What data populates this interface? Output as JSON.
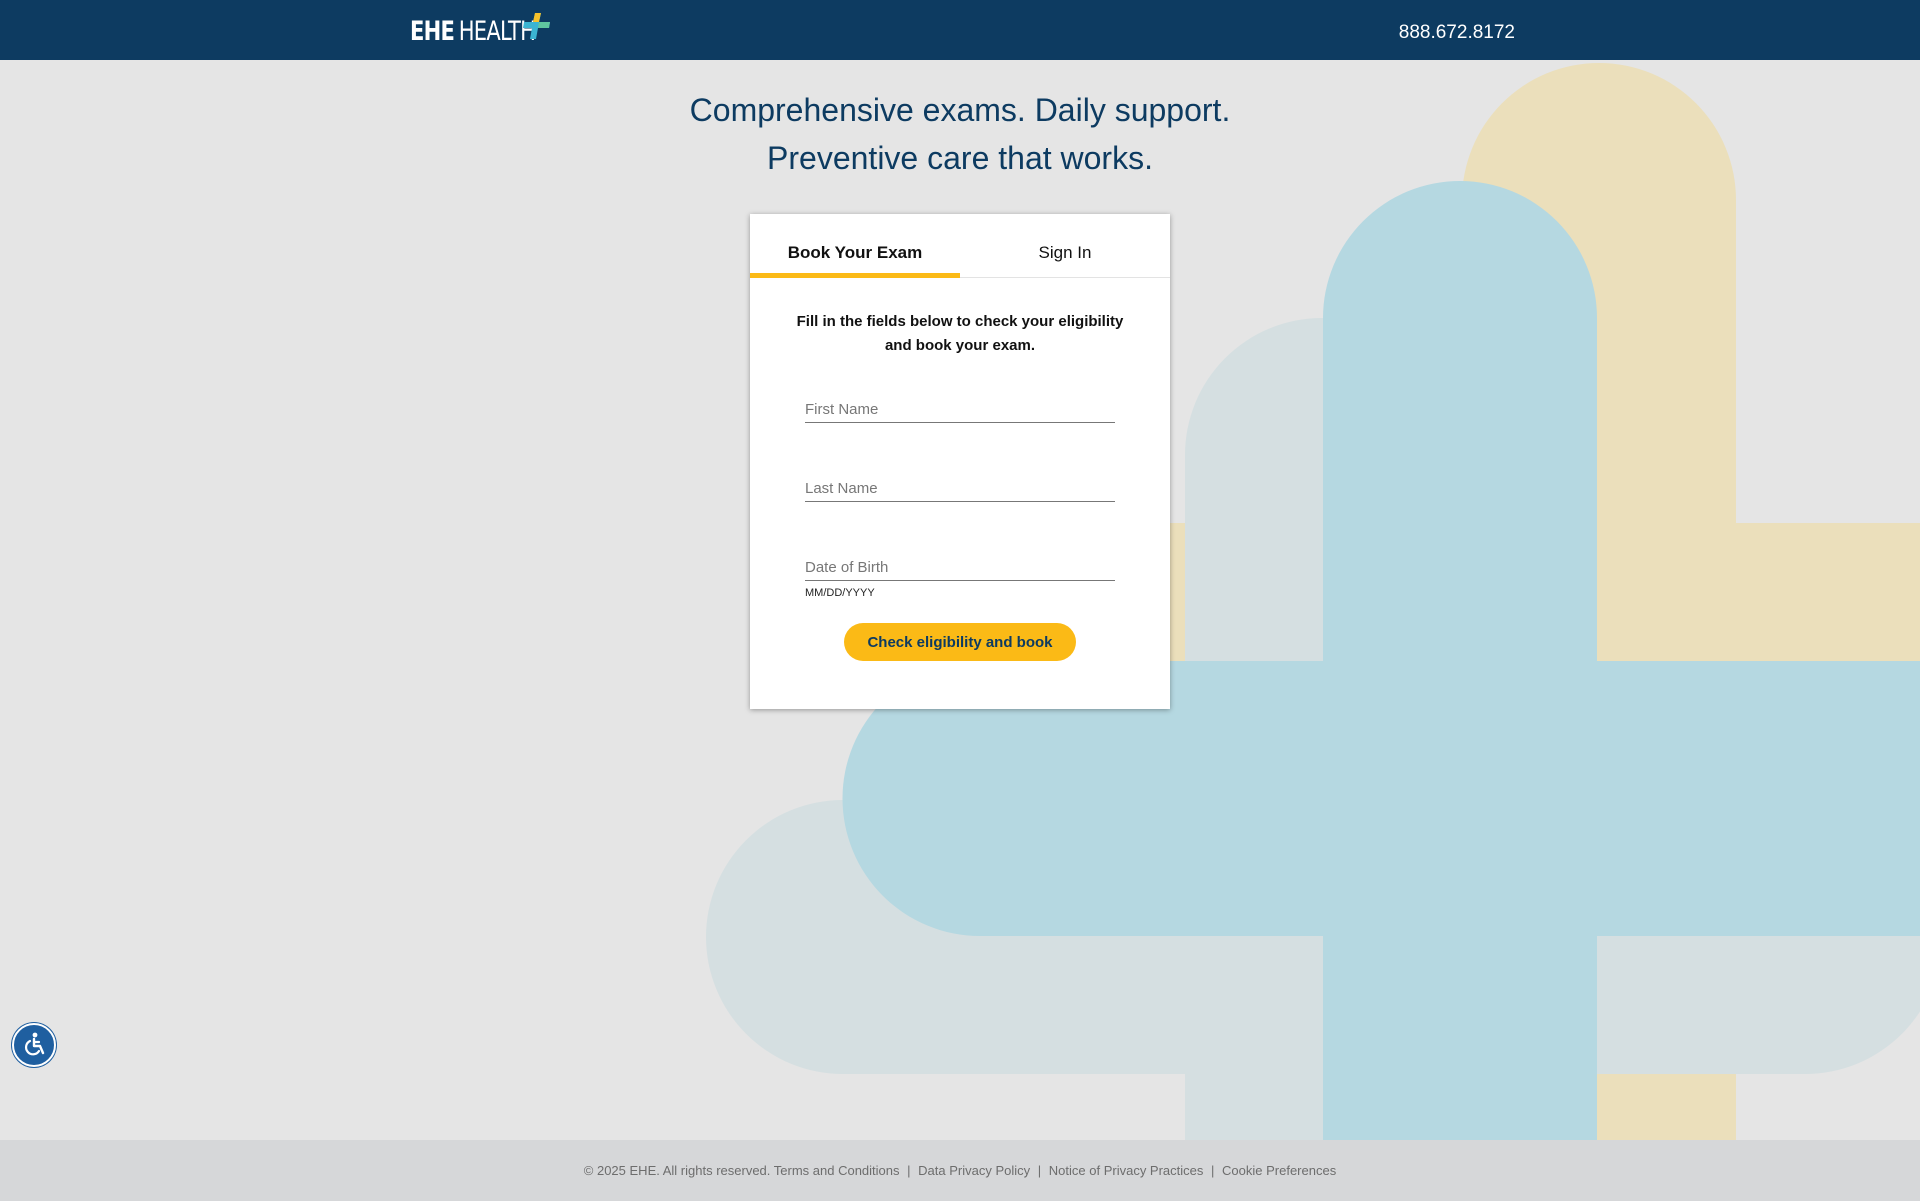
{
  "header": {
    "logo_primary": "EHE",
    "logo_secondary": "HEALTH",
    "phone": "888.672.8172"
  },
  "hero": {
    "line1": "Comprehensive exams. Daily support.",
    "line2": "Preventive care that works."
  },
  "card": {
    "tabs": [
      {
        "label": "Book Your Exam",
        "active": true
      },
      {
        "label": "Sign In",
        "active": false
      }
    ],
    "intro": "Fill in the fields below to check your eligibility and book your exam.",
    "fields": {
      "first_name": {
        "value": "",
        "placeholder": "First Name"
      },
      "last_name": {
        "value": "",
        "placeholder": "Last Name"
      },
      "dob": {
        "value": "",
        "placeholder": "Date of Birth",
        "hint": "MM/DD/YYYY"
      }
    },
    "submit_label": "Check eligibility and book"
  },
  "footer": {
    "copyright": "© 2025 EHE. All rights reserved.",
    "links": [
      "Terms and Conditions",
      "Data Privacy Policy",
      "Notice of Privacy Practices",
      "Cookie Preferences"
    ],
    "separator": "|"
  },
  "colors": {
    "header_bg": "#0d3b61",
    "accent_yellow": "#fbba16",
    "shape_yellow": "#ebdfbb",
    "shape_blue": "#b5d8e1",
    "shape_gray": "#d5dfe1",
    "page_bg": "#e5e5e5",
    "footer_bg": "#d6d7d9"
  },
  "icons": {
    "logo_mark": "plus-icon",
    "accessibility": "accessibility-icon"
  }
}
